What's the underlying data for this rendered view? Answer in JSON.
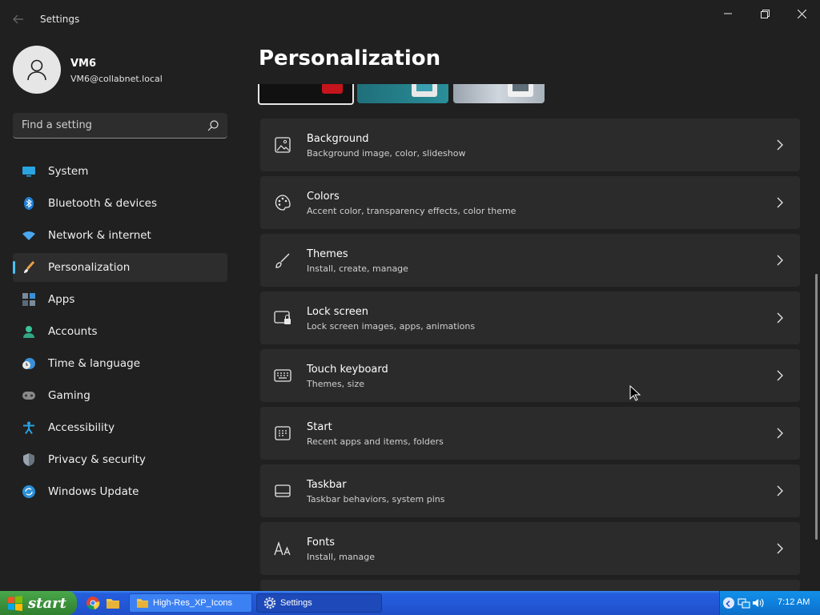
{
  "window": {
    "title": "Settings"
  },
  "profile": {
    "name": "VM6",
    "email": "VM6@collabnet.local"
  },
  "search": {
    "placeholder": "Find a setting"
  },
  "sidebar": {
    "items": [
      {
        "label": "System",
        "icon": "system-icon"
      },
      {
        "label": "Bluetooth & devices",
        "icon": "bluetooth-icon"
      },
      {
        "label": "Network & internet",
        "icon": "wifi-icon"
      },
      {
        "label": "Personalization",
        "icon": "brush-icon",
        "active": true
      },
      {
        "label": "Apps",
        "icon": "apps-icon"
      },
      {
        "label": "Accounts",
        "icon": "person-icon"
      },
      {
        "label": "Time & language",
        "icon": "clock-globe-icon"
      },
      {
        "label": "Gaming",
        "icon": "gamepad-icon"
      },
      {
        "label": "Accessibility",
        "icon": "accessibility-icon"
      },
      {
        "label": "Privacy & security",
        "icon": "shield-icon"
      },
      {
        "label": "Windows Update",
        "icon": "update-icon"
      }
    ]
  },
  "main": {
    "title": "Personalization",
    "cards": [
      {
        "title": "Background",
        "subtitle": "Background image, color, slideshow",
        "icon": "image-icon"
      },
      {
        "title": "Colors",
        "subtitle": "Accent color, transparency effects, color theme",
        "icon": "palette-icon"
      },
      {
        "title": "Themes",
        "subtitle": "Install, create, manage",
        "icon": "brush-icon"
      },
      {
        "title": "Lock screen",
        "subtitle": "Lock screen images, apps, animations",
        "icon": "lock-screen-icon"
      },
      {
        "title": "Touch keyboard",
        "subtitle": "Themes, size",
        "icon": "keyboard-icon"
      },
      {
        "title": "Start",
        "subtitle": "Recent apps and items, folders",
        "icon": "start-icon"
      },
      {
        "title": "Taskbar",
        "subtitle": "Taskbar behaviors, system pins",
        "icon": "taskbar-icon"
      },
      {
        "title": "Fonts",
        "subtitle": "Install, manage",
        "icon": "fonts-icon"
      }
    ]
  },
  "taskbar": {
    "start_label": "start",
    "tasks": [
      {
        "label": "High-Res_XP_Icons",
        "icon": "folder-icon"
      },
      {
        "label": "Settings",
        "icon": "gear-icon"
      }
    ],
    "clock": "7:12 AM"
  },
  "colors": {
    "accent": "#4cc2ff",
    "background": "#202020",
    "card": "#2b2b2b"
  }
}
